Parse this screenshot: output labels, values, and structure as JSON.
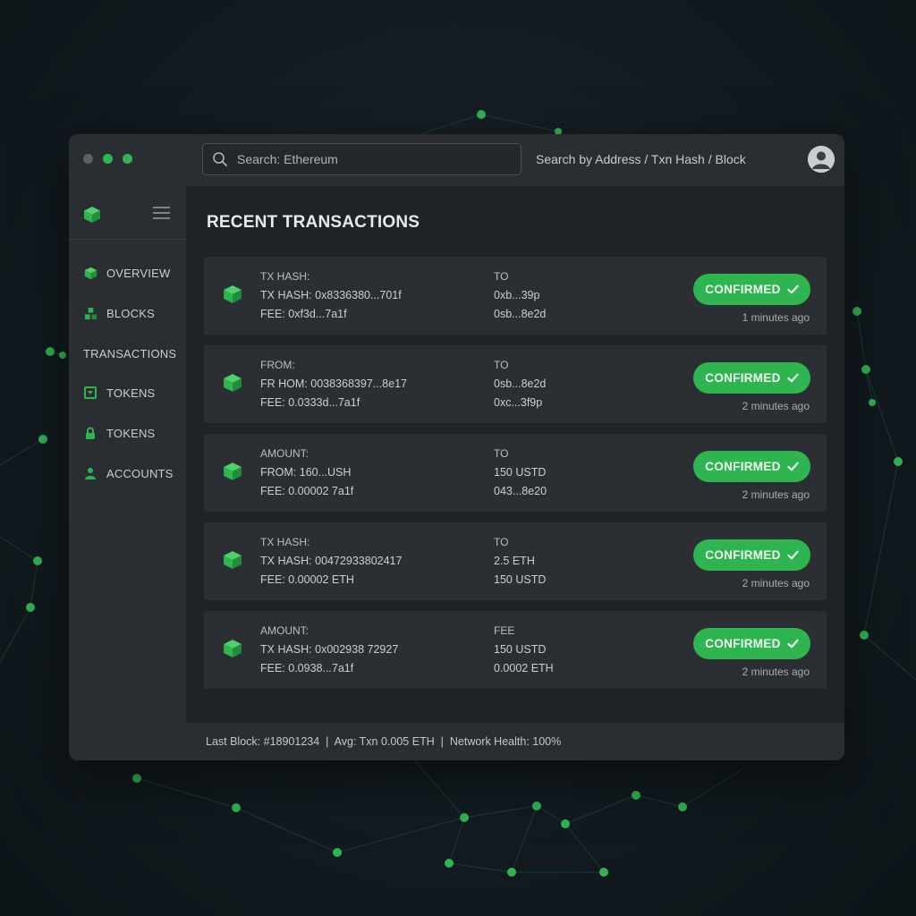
{
  "colors": {
    "accent": "#2fb54f",
    "window_bg": "#25292d",
    "sidebar_bg": "#2a2e32",
    "main_bg": "#1f2226",
    "row_bg": "#2b2f33"
  },
  "titlebar": {
    "search_value": "Search: Ethereum",
    "search_icon": "search-icon",
    "hint": "Search by Address / Txn Hash / Block",
    "avatar_icon": "user-avatar-icon"
  },
  "sidebar": {
    "logo_icon": "cube-logo-icon",
    "menu_icon": "hamburger-menu-icon",
    "items": [
      {
        "label": "OVERVIEW",
        "icon": "cube-icon"
      },
      {
        "label": "BLOCKS",
        "icon": "blocks-icon"
      },
      {
        "label": "TRANSACTIONS",
        "icon": ""
      },
      {
        "label": "TOKENS",
        "icon": "token-box-icon"
      },
      {
        "label": "TOKENS",
        "icon": "lock-icon"
      },
      {
        "label": "ACCOUNTS",
        "icon": "account-icon"
      }
    ]
  },
  "main": {
    "title": "RECENT TRANSACTIONS",
    "transactions": [
      {
        "col1": [
          "TX HASH:",
          "TX HASH: 0x8336380...701f",
          "FEE: 0xf3d...7a1f"
        ],
        "col2": [
          "TO",
          "0xb...39p",
          "0sb...8e2d"
        ],
        "status": "CONFIRMED",
        "time": "1 minutes ago"
      },
      {
        "col1": [
          "FROM:",
          "FR HOM: 0038368397...8e17",
          "FEE: 0.0333d...7a1f"
        ],
        "col2": [
          "TO",
          "0sb...8e2d",
          "0xc...3f9p"
        ],
        "status": "CONFIRMED",
        "time": "2 minutes ago"
      },
      {
        "col1": [
          "AMOUNT:",
          "FROM:  160...USH",
          "FEE: 0.00002 7a1f"
        ],
        "col2": [
          "TO",
          "150 USTD",
          "043...8e20"
        ],
        "status": "CONFIRMED",
        "time": "2 minutes ago"
      },
      {
        "col1": [
          "TX HASH:",
          "TX HASH: 00472933802417",
          "FEE: 0.00002 ETH"
        ],
        "col2": [
          "TO",
          "2.5 ETH",
          "150 USTD"
        ],
        "status": "CONFIRMED",
        "time": "2 minutes ago"
      },
      {
        "col1": [
          "AMOUNT:",
          "TX HASH: 0x002938 72927",
          "FEE: 0.0938...7a1f"
        ],
        "col2": [
          "FEE",
          "150 USTD",
          "0.0002 ETH"
        ],
        "status": "CONFIRMED",
        "time": "2 minutes ago"
      }
    ]
  },
  "statusbar": {
    "text": "Last Block: #18901234  |  Avg: Txn 0.005 ETH  |  Network Health: 100%"
  }
}
